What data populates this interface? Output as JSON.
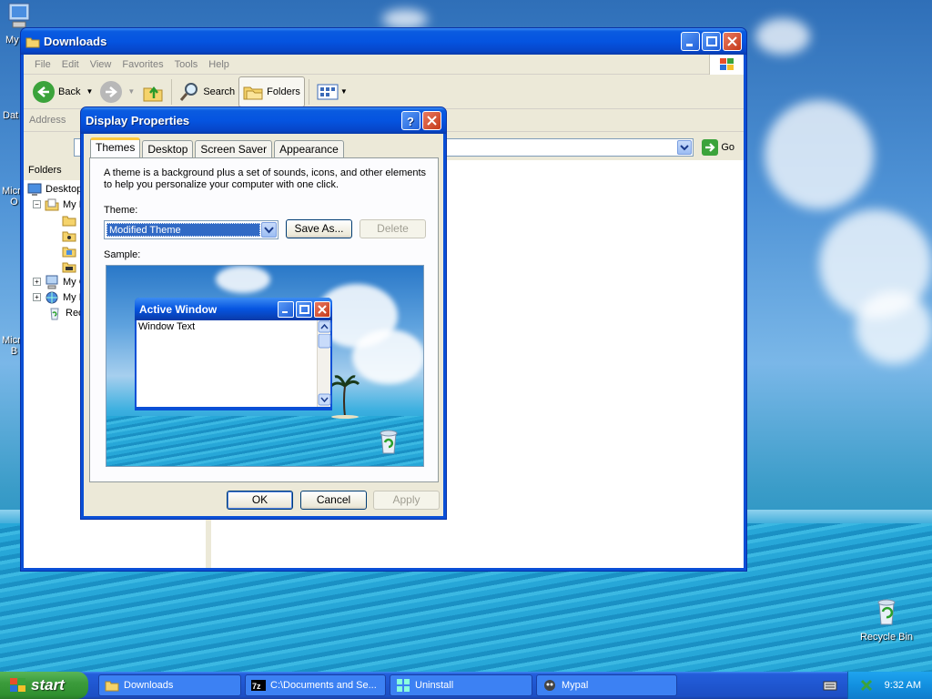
{
  "desktop": {
    "icons": [
      {
        "label": "My"
      },
      {
        "label": "Dat"
      },
      {
        "label": "Micro\nO"
      },
      {
        "label": "Micro\nB"
      },
      {
        "label": "Recycle Bin"
      }
    ]
  },
  "explorer": {
    "title": "Downloads",
    "menu": [
      "File",
      "Edit",
      "View",
      "Favorites",
      "Tools",
      "Help"
    ],
    "toolbar": {
      "back": "Back",
      "search": "Search",
      "folders": "Folders"
    },
    "address_label": "Address",
    "go_label": "Go",
    "folders_header": "Folders",
    "tree": [
      {
        "label": "Desktop"
      },
      {
        "label": "My D"
      },
      {
        "label": ""
      },
      {
        "label": ""
      },
      {
        "label": ""
      },
      {
        "label": ""
      },
      {
        "label": "My C"
      },
      {
        "label": "My N"
      },
      {
        "label": "Recy"
      }
    ]
  },
  "dialog": {
    "title": "Display Properties",
    "tabs": [
      "Themes",
      "Desktop",
      "Screen Saver",
      "Appearance"
    ],
    "description": "A theme is a background plus a set of sounds, icons, and other elements to help you personalize your computer with one click.",
    "theme_label": "Theme:",
    "theme_value": "Modified Theme",
    "save_as": "Save As...",
    "delete": "Delete",
    "sample_label": "Sample:",
    "sample_window": {
      "title": "Active Window",
      "text": "Window Text"
    },
    "ok": "OK",
    "cancel": "Cancel",
    "apply": "Apply"
  },
  "taskbar": {
    "start": "start",
    "tasks": [
      "Downloads",
      "C:\\Documents and Se...",
      "Uninstall",
      "Mypal"
    ],
    "clock": "9:32 AM"
  }
}
